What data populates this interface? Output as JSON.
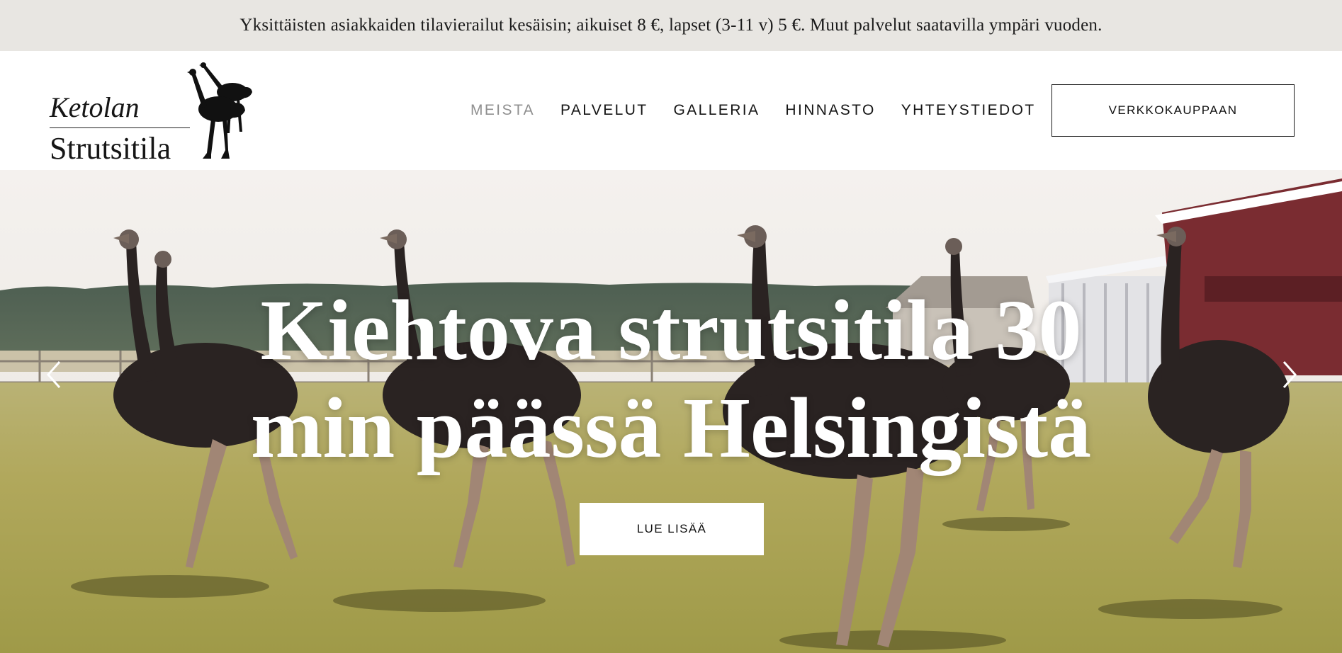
{
  "announcement": {
    "text": "Yksittäisten asiakkaiden tilavierailut kesäisin; aikuiset 8 €, lapset (3-11 v) 5 €. Muut palvelut saatavilla ympäri vuoden."
  },
  "header": {
    "logo": {
      "line1": "Ketolan",
      "line2": "Strutsitila",
      "icon": "ostrich-icon"
    },
    "nav": [
      {
        "label": "MEISTA",
        "active": true
      },
      {
        "label": "PALVELUT",
        "active": false
      },
      {
        "label": "GALLERIA",
        "active": false
      },
      {
        "label": "HINNASTO",
        "active": false
      },
      {
        "label": "YHTEYSTIEDOT",
        "active": false
      }
    ],
    "shop_button": "VERKKOKAUPPAAN"
  },
  "hero": {
    "title_line1": "Kiehtova strutsitila 30",
    "title_line2": "min päässä Helsingistä",
    "cta": "LUE LISÄÄ",
    "prev_icon": "chevron-left-icon",
    "next_icon": "chevron-right-icon"
  },
  "colors": {
    "announcement_bg": "#e8e6e2",
    "nav_active": "#8f8f8f",
    "text": "#151515"
  }
}
